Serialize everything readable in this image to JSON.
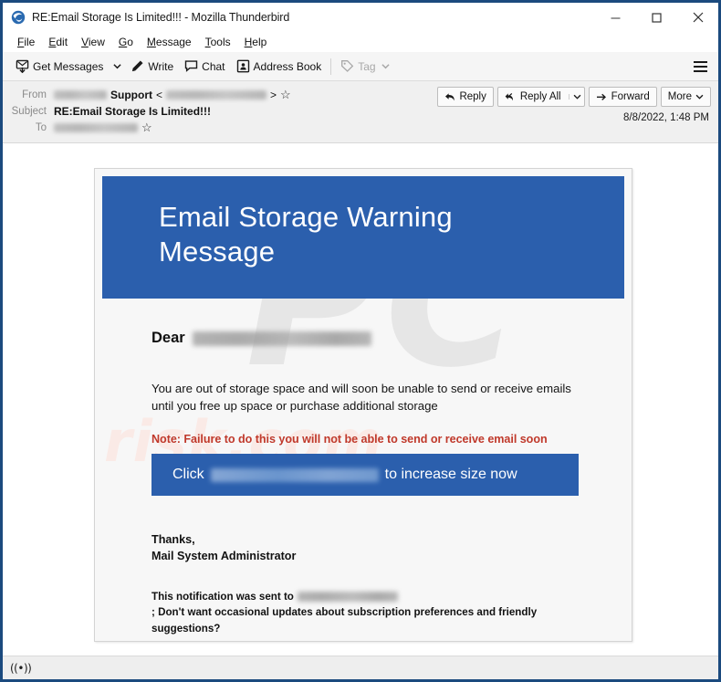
{
  "window": {
    "title": "RE:Email Storage Is Limited!!! - Mozilla Thunderbird",
    "app_icon": "thunderbird-icon",
    "controls": {
      "minimize": "minimize-icon",
      "maximize": "maximize-icon",
      "close": "close-icon"
    }
  },
  "menubar": {
    "items": [
      {
        "label": "File",
        "accel": "F"
      },
      {
        "label": "Edit",
        "accel": "E"
      },
      {
        "label": "View",
        "accel": "V"
      },
      {
        "label": "Go",
        "accel": "G"
      },
      {
        "label": "Message",
        "accel": "M"
      },
      {
        "label": "Tools",
        "accel": "T"
      },
      {
        "label": "Help",
        "accel": "H"
      }
    ]
  },
  "toolbar": {
    "get_messages": "Get Messages",
    "write": "Write",
    "chat": "Chat",
    "address_book": "Address Book",
    "tag": "Tag",
    "app_menu": "app-menu-icon"
  },
  "message_header": {
    "from_label": "From",
    "from_display": "Support",
    "subject_label": "Subject",
    "subject": "RE:Email Storage Is Limited!!!",
    "to_label": "To",
    "date": "8/8/2022, 1:48 PM",
    "actions": {
      "reply": "Reply",
      "reply_all": "Reply All",
      "forward": "Forward",
      "more": "More"
    }
  },
  "email": {
    "banner_title": "Email Storage Warning Message",
    "greeting": "Dear",
    "paragraph": "You are out of storage space and will soon be unable to send or receive emails until you free up space or purchase additional storage",
    "note": "Note: Failure to do this you will not be able to send or receive email soon",
    "cta_prefix": "Click",
    "cta_suffix": "to increase size now",
    "signoff_line1": "Thanks,",
    "signoff_line2": "Mail System Administrator",
    "fineprint_prefix": "This notification was sent to",
    "fineprint_suffix": "; Don't want occasional updates about subscription preferences and friendly suggestions?",
    "banner_color": "#2b5fad",
    "cta_color": "#2b5fad",
    "note_color": "#c0392b",
    "watermark_big": "PC",
    "watermark_small": "risk.com"
  },
  "statusbar": {
    "network_indicator": "((•))"
  }
}
